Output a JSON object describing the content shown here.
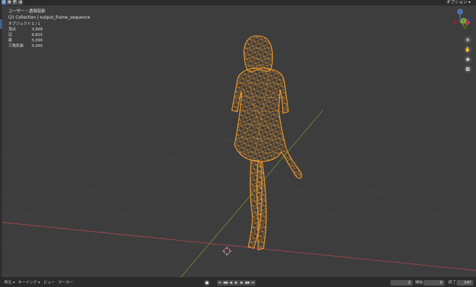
{
  "header": {
    "options_label": "オプション ▾",
    "select_modes": [
      "▦",
      "▣",
      "◩",
      "◪"
    ]
  },
  "viewport": {
    "view_name": "ユーザー・透視投影",
    "collection": "(2) Collection | output_frame_sequence",
    "stats": [
      {
        "label": "オブジェクト",
        "value": "1 / 1"
      },
      {
        "label": "頂点",
        "value": "3,908"
      },
      {
        "label": "辺",
        "value": "8,825"
      },
      {
        "label": "面",
        "value": "5,000"
      },
      {
        "label": "三角形面",
        "value": "5,000"
      }
    ],
    "gizmo": {
      "z": "Z",
      "y": "Y",
      "x": "X"
    },
    "nav_icons": [
      "zoom-icon",
      "hand-icon",
      "camera-icon",
      "grid-view-icon"
    ],
    "colors": {
      "wireframe": "#ff9a1f",
      "x_axis": "#b04a56",
      "y_axis": "#7a9a3a",
      "grid": "#4a4a4a"
    }
  },
  "timeline": {
    "menus": [
      "再生 ▾",
      "キーイング ▾",
      "ビュー",
      "マーカー"
    ],
    "controls": [
      "⏮",
      "◀◆",
      "◀",
      "▶",
      "▶",
      "◆▶",
      "⏭"
    ],
    "current_frame": "2",
    "start_label": "開始",
    "start_value": "0",
    "end_label": "終了",
    "end_value": "147"
  }
}
